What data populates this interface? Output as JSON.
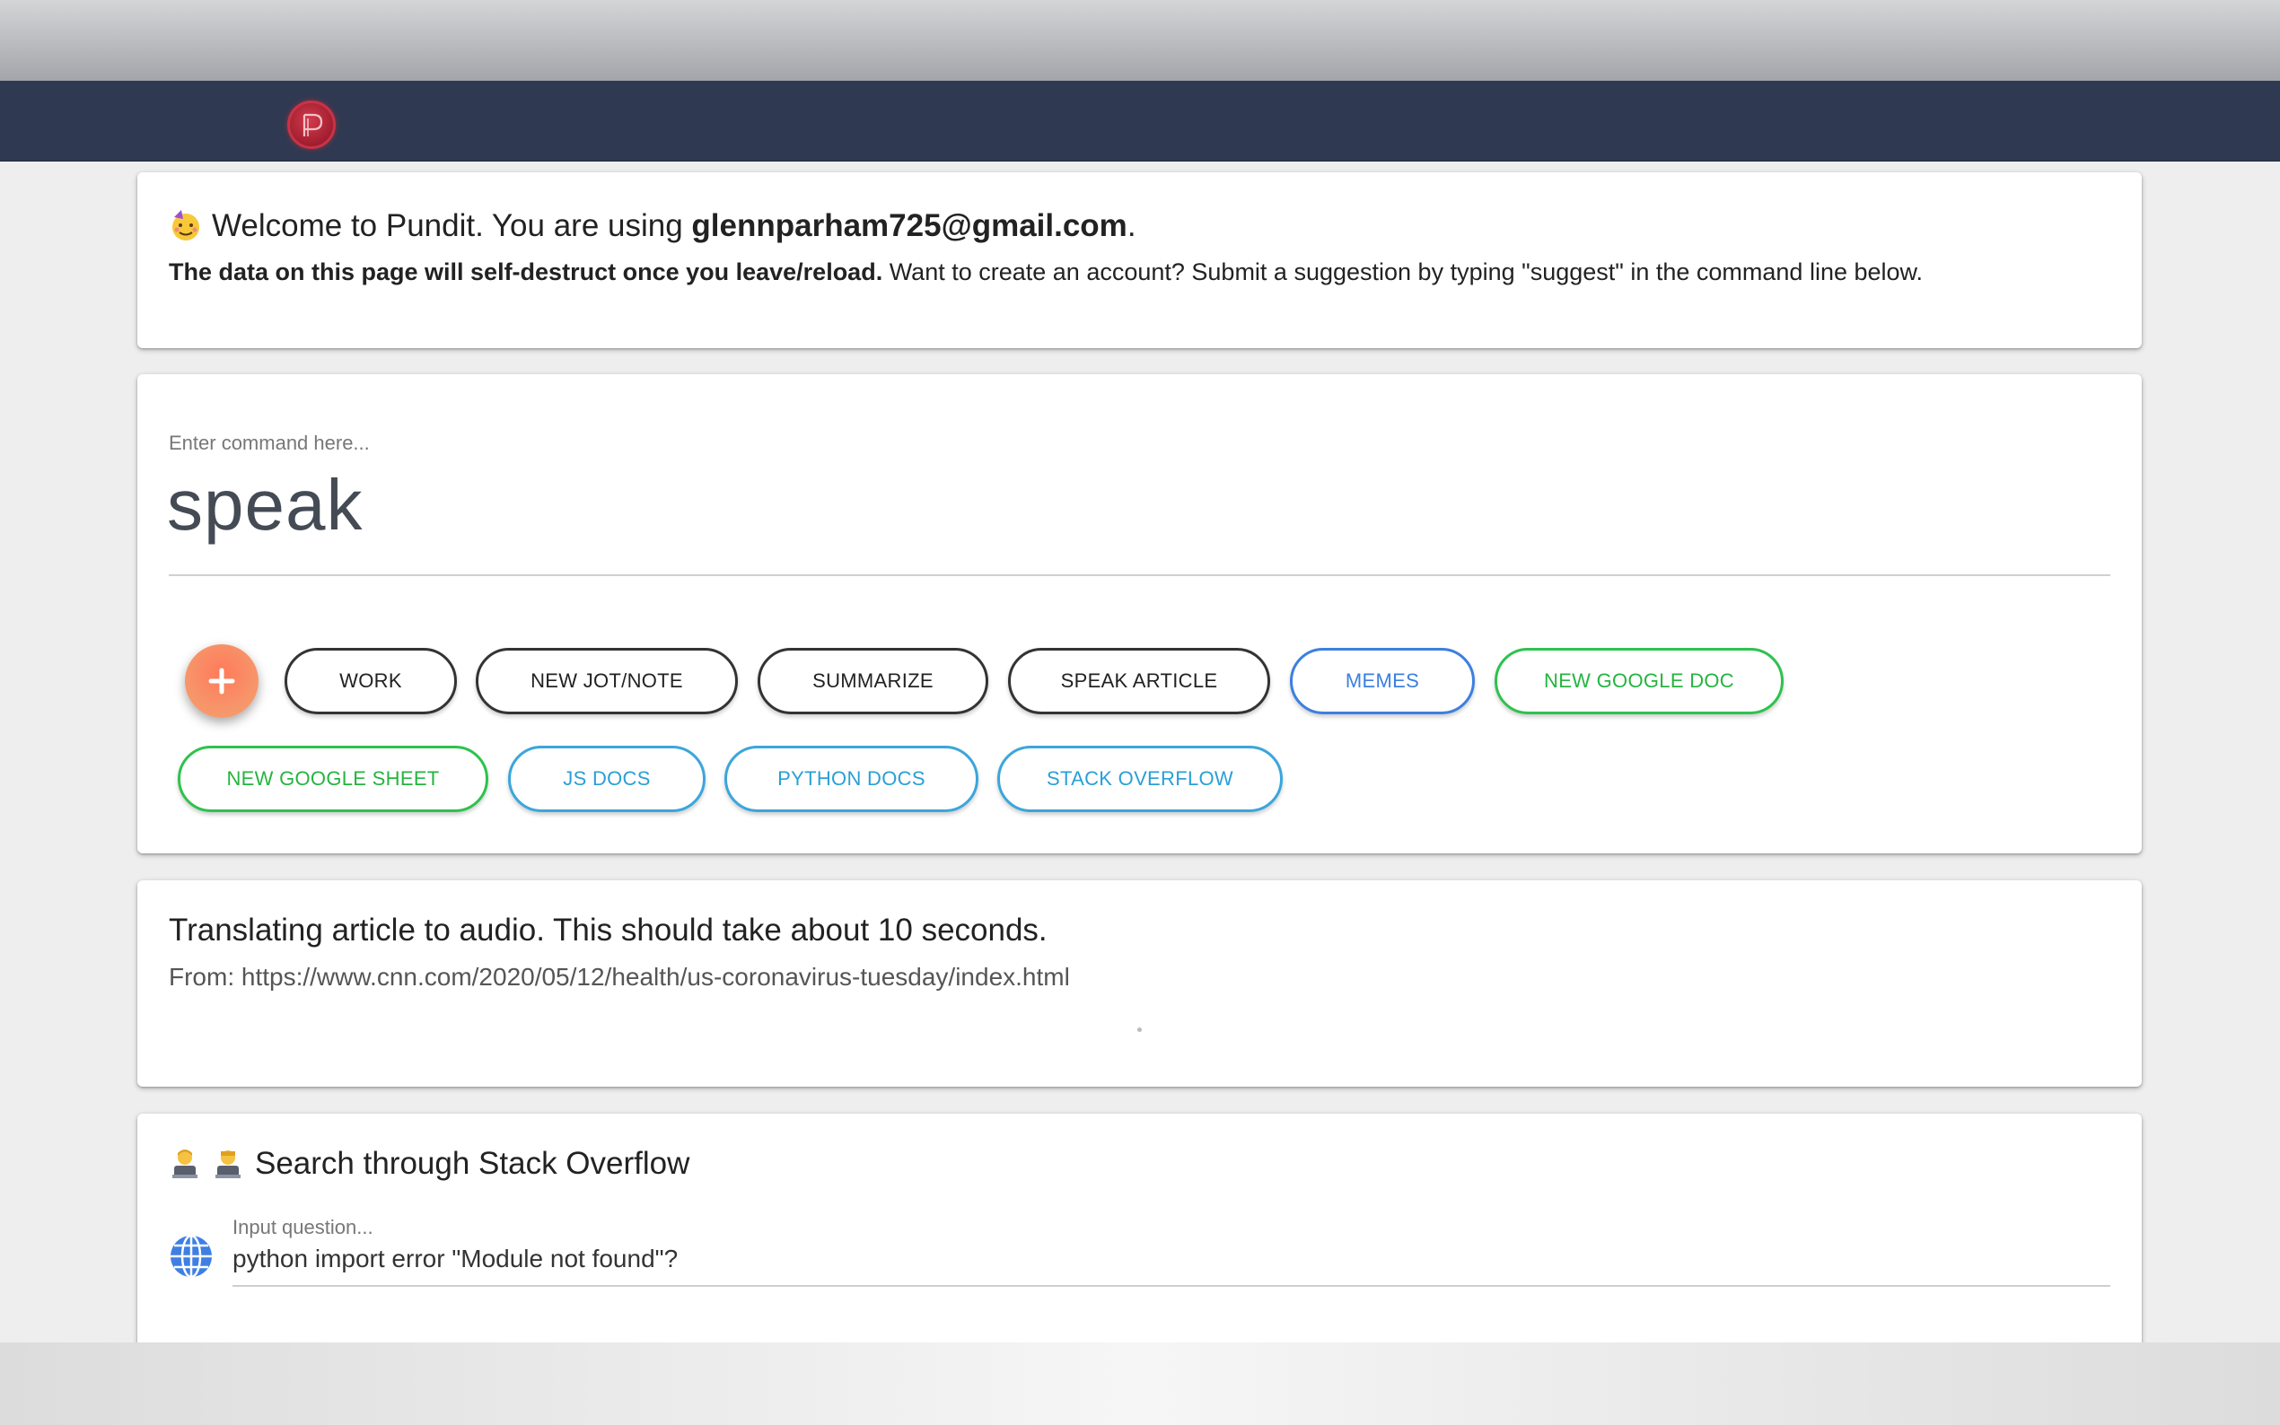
{
  "navbar": {
    "logo_icon": "pundit-logo",
    "accent": "#2f3a52"
  },
  "welcome": {
    "prefix": "Welcome to Pundit. You are using ",
    "email": "glennparham725@gmail.com",
    "suffix": ".",
    "notice_bold": "The data on this page will self-destruct once you leave/reload.",
    "notice_rest": " Want to create an account? Submit a suggestion by typing \"suggest\" in the command line below."
  },
  "command": {
    "placeholder": "Enter command here...",
    "value": "speak",
    "fab_icon": "plus-icon",
    "chips": [
      {
        "label": "WORK",
        "color": "#333333"
      },
      {
        "label": "NEW JOT/NOTE",
        "color": "#333333"
      },
      {
        "label": "SUMMARIZE",
        "color": "#333333"
      },
      {
        "label": "SPEAK ARTICLE",
        "color": "#333333"
      },
      {
        "label": "MEMES",
        "color": "#3c7fe0"
      },
      {
        "label": "NEW GOOGLE DOC",
        "color": "#2ec24d"
      },
      {
        "label": "NEW GOOGLE SHEET",
        "color": "#2ec24d"
      },
      {
        "label": "JS DOCS",
        "color": "#3aa6dc"
      },
      {
        "label": "PYTHON DOCS",
        "color": "#3aa6dc"
      },
      {
        "label": "STACK OVERFLOW",
        "color": "#3aa6dc"
      }
    ]
  },
  "translate": {
    "title": "Translating article to audio. This should take about 10 seconds.",
    "from": "From: https://www.cnn.com/2020/05/12/health/us-coronavirus-tuesday/index.html"
  },
  "stackoverflow": {
    "title": "Search through Stack Overflow",
    "input_label": "Input question...",
    "input_value": "python import error \"Module not found\"?",
    "icon": "globe-icon"
  }
}
